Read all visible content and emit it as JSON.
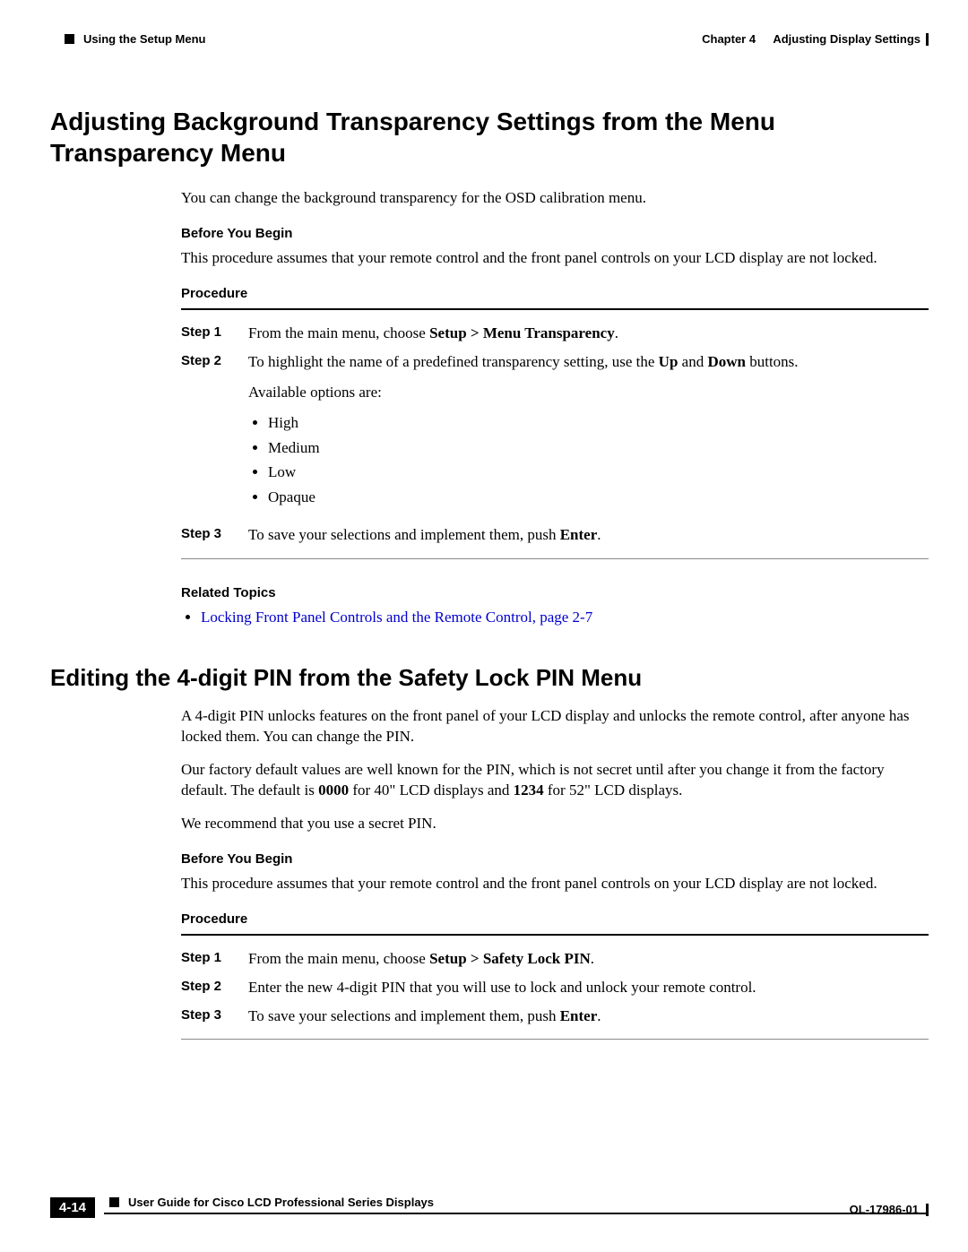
{
  "header": {
    "section": "Using the Setup Menu",
    "chapter_label": "Chapter 4",
    "chapter_title": "Adjusting Display Settings"
  },
  "section1": {
    "title": "Adjusting Background Transparency Settings from the Menu Transparency Menu",
    "intro": "You can change the background transparency for the OSD calibration menu.",
    "before_label": "Before You Begin",
    "before_text": "This procedure assumes that your remote control and the front panel controls on your LCD display are not locked.",
    "procedure_label": "Procedure",
    "steps": [
      {
        "label": "Step 1",
        "text_a": "From the main menu, choose ",
        "bold_a": "Setup > Menu Transparency",
        "text_b": "."
      },
      {
        "label": "Step 2",
        "text_a": "To highlight the name of a predefined transparency setting, use the ",
        "bold_a": "Up",
        "text_b": " and ",
        "bold_b": "Down",
        "text_c": " buttons.",
        "sub": "Available options are:",
        "options": [
          "High",
          "Medium",
          "Low",
          "Opaque"
        ]
      },
      {
        "label": "Step 3",
        "text_a": "To save your selections and implement them, push ",
        "bold_a": "Enter",
        "text_b": "."
      }
    ],
    "related_label": "Related Topics",
    "related_link": "Locking Front Panel Controls and the Remote Control, page 2-7"
  },
  "section2": {
    "title": "Editing the 4-digit PIN from the Safety Lock PIN Menu",
    "p1": "A 4-digit PIN unlocks features on the front panel of your LCD display and unlocks the remote control, after anyone has locked them. You can change the PIN.",
    "p2_a": "Our factory default values are well known for the PIN, which is not secret until after you change it from the factory default. The default is ",
    "p2_b1": "0000",
    "p2_b": " for 40\" LCD displays and ",
    "p2_b2": "1234",
    "p2_c": " for 52\" LCD displays.",
    "p3": "We recommend that you use a secret PIN.",
    "before_label": "Before You Begin",
    "before_text": "This procedure assumes that your remote control and the front panel controls on your LCD display are not locked.",
    "procedure_label": "Procedure",
    "steps": [
      {
        "label": "Step 1",
        "text_a": "From the main menu, choose ",
        "bold_a": "Setup > Safety Lock PIN",
        "text_b": "."
      },
      {
        "label": "Step 2",
        "text_a": "Enter the new 4-digit PIN that you will use to lock and unlock your remote control."
      },
      {
        "label": "Step 3",
        "text_a": "To save your selections and implement them, push ",
        "bold_a": "Enter",
        "text_b": "."
      }
    ]
  },
  "footer": {
    "guide_title": "User Guide for Cisco LCD Professional Series Displays",
    "page_num": "4-14",
    "doc_id": "OL-17986-01"
  }
}
